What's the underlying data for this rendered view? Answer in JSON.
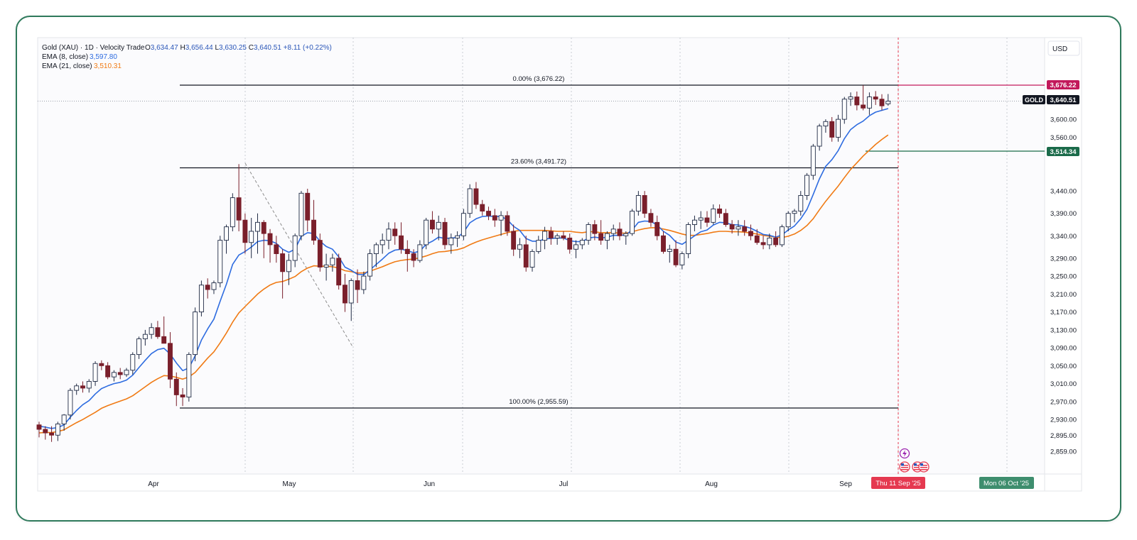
{
  "legend": {
    "title": "Gold (XAU) · 1D · Velocity Trade",
    "ohlc": [
      {
        "key": "O",
        "value": "3,634.47"
      },
      {
        "key": "H",
        "value": "3,656.44"
      },
      {
        "key": "L",
        "value": "3,630.25"
      },
      {
        "key": "C",
        "value": "3,640.51"
      }
    ],
    "change": "+8.11 (+0.22%)",
    "ema8_label": "EMA (8, close)",
    "ema8_value": "3,597.80",
    "ema21_label": "EMA (21, close)",
    "ema21_value": "3,510.31"
  },
  "currency": "USD",
  "price_axis": {
    "ticks": [
      "3,600.00",
      "3,560.00",
      "3,440.00",
      "3,390.00",
      "3,340.00",
      "3,290.00",
      "3,250.00",
      "3,210.00",
      "3,170.00",
      "3,130.00",
      "3,090.00",
      "3,050.00",
      "3,010.00",
      "2,970.00",
      "2,930.00",
      "2,895.00",
      "2,859.00"
    ],
    "price_tag": {
      "label": "GOLD",
      "value": "3,640.51"
    },
    "fib_high_tag": "3,676.22",
    "ema_tag": "3,514.34"
  },
  "time_axis": {
    "months": [
      "Apr",
      "May",
      "Jun",
      "Jul",
      "Aug",
      "Sep"
    ],
    "cursor_date": "Thu 11 Sep '25",
    "future_date": "Mon 06 Oct '25"
  },
  "fib_levels": [
    {
      "label": "0.00% (3,676.22)",
      "price": 3676.22
    },
    {
      "label": "23.60% (3,491.72)",
      "price": 3491.72
    },
    {
      "label": "100.00% (2,955.59)",
      "price": 2955.59
    }
  ],
  "colors": {
    "up_body": "#ffffff",
    "candle_border": "#1f2a44",
    "down_body": "#7a1f2b",
    "ema8": "#2e6ce0",
    "ema21": "#f07a14",
    "fib_tag": "#c2185b",
    "ema_tag": "#1b6b4a",
    "cursor_tag": "#e53950",
    "future_tag": "#3e8e6e"
  },
  "event_icons": [
    "lightning-icon",
    "us-flag-icon",
    "us-flag-icon",
    "us-flag-icon"
  ],
  "chart_data": {
    "type": "candlestick",
    "title": "Gold (XAU) · 1D · Velocity Trade",
    "x_months": [
      "Apr",
      "May",
      "Jun",
      "Jul",
      "Aug",
      "Sep"
    ],
    "y_ticks": [
      3600,
      3560,
      3440,
      3390,
      3340,
      3290,
      3250,
      3210,
      3170,
      3130,
      3090,
      3050,
      3010,
      2970,
      2930,
      2895,
      2859
    ],
    "ylim": [
      2830,
      3720
    ],
    "grid": "vertical dotted at month boundaries",
    "legend_position": "top-left",
    "candles": [
      [
        2918,
        2925,
        2890,
        2908
      ],
      [
        2908,
        2915,
        2885,
        2900
      ],
      [
        2900,
        2915,
        2880,
        2895
      ],
      [
        2895,
        2925,
        2882,
        2920
      ],
      [
        2920,
        2942,
        2905,
        2940
      ],
      [
        2940,
        3000,
        2930,
        2995
      ],
      [
        2995,
        3010,
        2985,
        3005
      ],
      [
        3005,
        3015,
        2990,
        3000
      ],
      [
        3000,
        3020,
        2990,
        3015
      ],
      [
        3015,
        3060,
        3005,
        3055
      ],
      [
        3055,
        3062,
        3040,
        3050
      ],
      [
        3050,
        3058,
        3020,
        3025
      ],
      [
        3025,
        3040,
        3015,
        3035
      ],
      [
        3035,
        3045,
        3020,
        3030
      ],
      [
        3030,
        3045,
        3025,
        3040
      ],
      [
        3040,
        3080,
        3030,
        3075
      ],
      [
        3075,
        3115,
        3065,
        3110
      ],
      [
        3110,
        3130,
        3095,
        3120
      ],
      [
        3120,
        3145,
        3110,
        3135
      ],
      [
        3135,
        3150,
        3110,
        3115
      ],
      [
        3115,
        3160,
        3100,
        3100
      ],
      [
        3100,
        3125,
        3000,
        3020
      ],
      [
        3020,
        3035,
        2960,
        2985
      ],
      [
        2985,
        3000,
        2960,
        2980
      ],
      [
        2980,
        3080,
        2970,
        3075
      ],
      [
        3075,
        3180,
        3060,
        3170
      ],
      [
        3170,
        3240,
        3160,
        3230
      ],
      [
        3230,
        3245,
        3200,
        3220
      ],
      [
        3220,
        3240,
        3210,
        3235
      ],
      [
        3235,
        3340,
        3225,
        3330
      ],
      [
        3330,
        3365,
        3300,
        3360
      ],
      [
        3360,
        3435,
        3350,
        3425
      ],
      [
        3425,
        3500,
        3350,
        3375
      ],
      [
        3375,
        3390,
        3300,
        3325
      ],
      [
        3325,
        3380,
        3290,
        3350
      ],
      [
        3350,
        3390,
        3300,
        3370
      ],
      [
        3370,
        3375,
        3290,
        3345
      ],
      [
        3345,
        3355,
        3280,
        3320
      ],
      [
        3320,
        3340,
        3280,
        3300
      ],
      [
        3300,
        3310,
        3200,
        3260
      ],
      [
        3260,
        3300,
        3230,
        3285
      ],
      [
        3285,
        3345,
        3270,
        3340
      ],
      [
        3340,
        3440,
        3330,
        3435
      ],
      [
        3435,
        3445,
        3350,
        3375
      ],
      [
        3375,
        3420,
        3320,
        3330
      ],
      [
        3330,
        3345,
        3260,
        3270
      ],
      [
        3270,
        3300,
        3240,
        3275
      ],
      [
        3275,
        3300,
        3260,
        3290
      ],
      [
        3290,
        3300,
        3220,
        3230
      ],
      [
        3230,
        3255,
        3170,
        3190
      ],
      [
        3190,
        3245,
        3150,
        3240
      ],
      [
        3240,
        3265,
        3190,
        3220
      ],
      [
        3220,
        3260,
        3210,
        3250
      ],
      [
        3250,
        3310,
        3240,
        3300
      ],
      [
        3300,
        3325,
        3270,
        3320
      ],
      [
        3320,
        3345,
        3300,
        3330
      ],
      [
        3330,
        3370,
        3310,
        3355
      ],
      [
        3355,
        3370,
        3320,
        3340
      ],
      [
        3340,
        3370,
        3300,
        3310
      ],
      [
        3310,
        3330,
        3260,
        3300
      ],
      [
        3300,
        3310,
        3270,
        3285
      ],
      [
        3285,
        3330,
        3280,
        3320
      ],
      [
        3320,
        3380,
        3310,
        3375
      ],
      [
        3375,
        3395,
        3345,
        3355
      ],
      [
        3355,
        3385,
        3330,
        3370
      ],
      [
        3370,
        3380,
        3310,
        3320
      ],
      [
        3320,
        3345,
        3300,
        3335
      ],
      [
        3335,
        3350,
        3315,
        3340
      ],
      [
        3340,
        3400,
        3330,
        3390
      ],
      [
        3390,
        3455,
        3380,
        3445
      ],
      [
        3445,
        3460,
        3400,
        3410
      ],
      [
        3410,
        3420,
        3385,
        3395
      ],
      [
        3395,
        3405,
        3375,
        3385
      ],
      [
        3385,
        3400,
        3360,
        3375
      ],
      [
        3375,
        3395,
        3340,
        3385
      ],
      [
        3385,
        3395,
        3340,
        3350
      ],
      [
        3350,
        3365,
        3295,
        3310
      ],
      [
        3310,
        3335,
        3290,
        3320
      ],
      [
        3320,
        3340,
        3260,
        3270
      ],
      [
        3270,
        3310,
        3260,
        3305
      ],
      [
        3305,
        3340,
        3300,
        3330
      ],
      [
        3330,
        3360,
        3310,
        3350
      ],
      [
        3350,
        3360,
        3320,
        3335
      ],
      [
        3335,
        3345,
        3320,
        3340
      ],
      [
        3340,
        3350,
        3330,
        3335
      ],
      [
        3335,
        3345,
        3300,
        3310
      ],
      [
        3310,
        3330,
        3290,
        3320
      ],
      [
        3320,
        3335,
        3310,
        3330
      ],
      [
        3330,
        3370,
        3320,
        3365
      ],
      [
        3365,
        3375,
        3330,
        3345
      ],
      [
        3345,
        3375,
        3320,
        3330
      ],
      [
        3330,
        3350,
        3310,
        3345
      ],
      [
        3345,
        3365,
        3330,
        3355
      ],
      [
        3355,
        3370,
        3330,
        3340
      ],
      [
        3340,
        3350,
        3320,
        3345
      ],
      [
        3345,
        3400,
        3340,
        3395
      ],
      [
        3395,
        3440,
        3385,
        3430
      ],
      [
        3430,
        3440,
        3380,
        3390
      ],
      [
        3390,
        3400,
        3360,
        3370
      ],
      [
        3370,
        3385,
        3330,
        3340
      ],
      [
        3340,
        3350,
        3300,
        3305
      ],
      [
        3305,
        3320,
        3280,
        3310
      ],
      [
        3310,
        3330,
        3270,
        3275
      ],
      [
        3275,
        3305,
        3265,
        3300
      ],
      [
        3300,
        3370,
        3290,
        3365
      ],
      [
        3365,
        3385,
        3350,
        3375
      ],
      [
        3375,
        3395,
        3355,
        3380
      ],
      [
        3380,
        3395,
        3360,
        3370
      ],
      [
        3370,
        3410,
        3365,
        3400
      ],
      [
        3400,
        3410,
        3380,
        3390
      ],
      [
        3390,
        3400,
        3360,
        3365
      ],
      [
        3365,
        3375,
        3345,
        3355
      ],
      [
        3355,
        3375,
        3340,
        3360
      ],
      [
        3360,
        3375,
        3340,
        3350
      ],
      [
        3350,
        3365,
        3330,
        3340
      ],
      [
        3340,
        3355,
        3320,
        3325
      ],
      [
        3325,
        3340,
        3310,
        3320
      ],
      [
        3320,
        3345,
        3310,
        3335
      ],
      [
        3335,
        3350,
        3315,
        3320
      ],
      [
        3320,
        3365,
        3315,
        3360
      ],
      [
        3360,
        3395,
        3350,
        3390
      ],
      [
        3390,
        3400,
        3370,
        3395
      ],
      [
        3395,
        3440,
        3385,
        3430
      ],
      [
        3430,
        3480,
        3420,
        3475
      ],
      [
        3475,
        3545,
        3465,
        3540
      ],
      [
        3540,
        3590,
        3530,
        3585
      ],
      [
        3585,
        3600,
        3570,
        3595
      ],
      [
        3595,
        3605,
        3550,
        3560
      ],
      [
        3560,
        3610,
        3550,
        3600
      ],
      [
        3600,
        3650,
        3590,
        3645
      ],
      [
        3645,
        3660,
        3630,
        3650
      ],
      [
        3650,
        3662,
        3620,
        3632
      ],
      [
        3632,
        3676,
        3620,
        3625
      ],
      [
        3625,
        3660,
        3610,
        3650
      ],
      [
        3650,
        3663,
        3632,
        3645
      ],
      [
        3645,
        3656,
        3620,
        3630
      ],
      [
        3634.47,
        3656.44,
        3630.25,
        3640.51
      ]
    ],
    "ema8": [
      2915,
      2913,
      2910,
      2912,
      2918,
      2935,
      2950,
      2963,
      2972,
      2987,
      2999,
      3005,
      3010,
      3013,
      3018,
      3029,
      3046,
      3062,
      3077,
      3086,
      3089,
      3076,
      3056,
      3039,
      3045,
      3072,
      3107,
      3132,
      3154,
      3194,
      3232,
      3276,
      3297,
      3305,
      3315,
      3327,
      3330,
      3329,
      3323,
      3310,
      3303,
      3310,
      3339,
      3347,
      3345,
      3328,
      3316,
      3310,
      3293,
      3270,
      3263,
      3254,
      3253,
      3264,
      3276,
      3288,
      3301,
      3308,
      3310,
      3307,
      3302,
      3306,
      3321,
      3328,
      3337,
      3334,
      3335,
      3336,
      3348,
      3369,
      3378,
      3383,
      3384,
      3383,
      3383,
      3376,
      3361,
      3352,
      3334,
      3328,
      3328,
      3333,
      3334,
      3335,
      3335,
      3329,
      3327,
      3327,
      3335,
      3337,
      3335,
      3337,
      3341,
      3341,
      3342,
      3353,
      3370,
      3373,
      3372,
      3364,
      3350,
      3341,
      3326,
      3321,
      3330,
      3340,
      3349,
      3353,
      3364,
      3370,
      3369,
      3365,
      3364,
      3361,
      3357,
      3350,
      3343,
      3341,
      3337,
      3342,
      3353,
      3362,
      3378,
      3399,
      3432,
      3467,
      3495,
      3510,
      3530,
      3557,
      3577,
      3588,
      3596,
      3608,
      3616,
      3620,
      3624
    ],
    "ema21": [
      2900,
      2901,
      2901,
      2903,
      2907,
      2915,
      2923,
      2930,
      2938,
      2946,
      2955,
      2961,
      2966,
      2971,
      2976,
      2983,
      2993,
      3003,
      3013,
      3021,
      3028,
      3027,
      3024,
      3020,
      3025,
      3035,
      3051,
      3067,
      3081,
      3101,
      3123,
      3147,
      3168,
      3182,
      3196,
      3210,
      3221,
      3230,
      3236,
      3238,
      3243,
      3249,
      3260,
      3268,
      3273,
      3272,
      3272,
      3271,
      3268,
      3262,
      3260,
      3257,
      3257,
      3261,
      3266,
      3271,
      3277,
      3282,
      3285,
      3287,
      3288,
      3291,
      3295,
      3300,
      3304,
      3305,
      3307,
      3309,
      3313,
      3320,
      3326,
      3331,
      3335,
      3339,
      3343,
      3347,
      3350,
      3352,
      3352,
      3352,
      3352,
      3352,
      3351,
      3350,
      3350,
      3350,
      3348,
      3347,
      3349,
      3349,
      3347,
      3347,
      3347,
      3346,
      3346,
      3349,
      3353,
      3356,
      3358,
      3358,
      3355,
      3352,
      3348,
      3344,
      3341,
      3341,
      3343,
      3345,
      3348,
      3350,
      3350,
      3349,
      3349,
      3348,
      3346,
      3344,
      3341,
      3339,
      3337,
      3336,
      3339,
      3344,
      3352,
      3363,
      3378,
      3398,
      3417,
      3434,
      3451,
      3470,
      3488,
      3503,
      3518,
      3531,
      3544,
      3555,
      3565
    ]
  }
}
